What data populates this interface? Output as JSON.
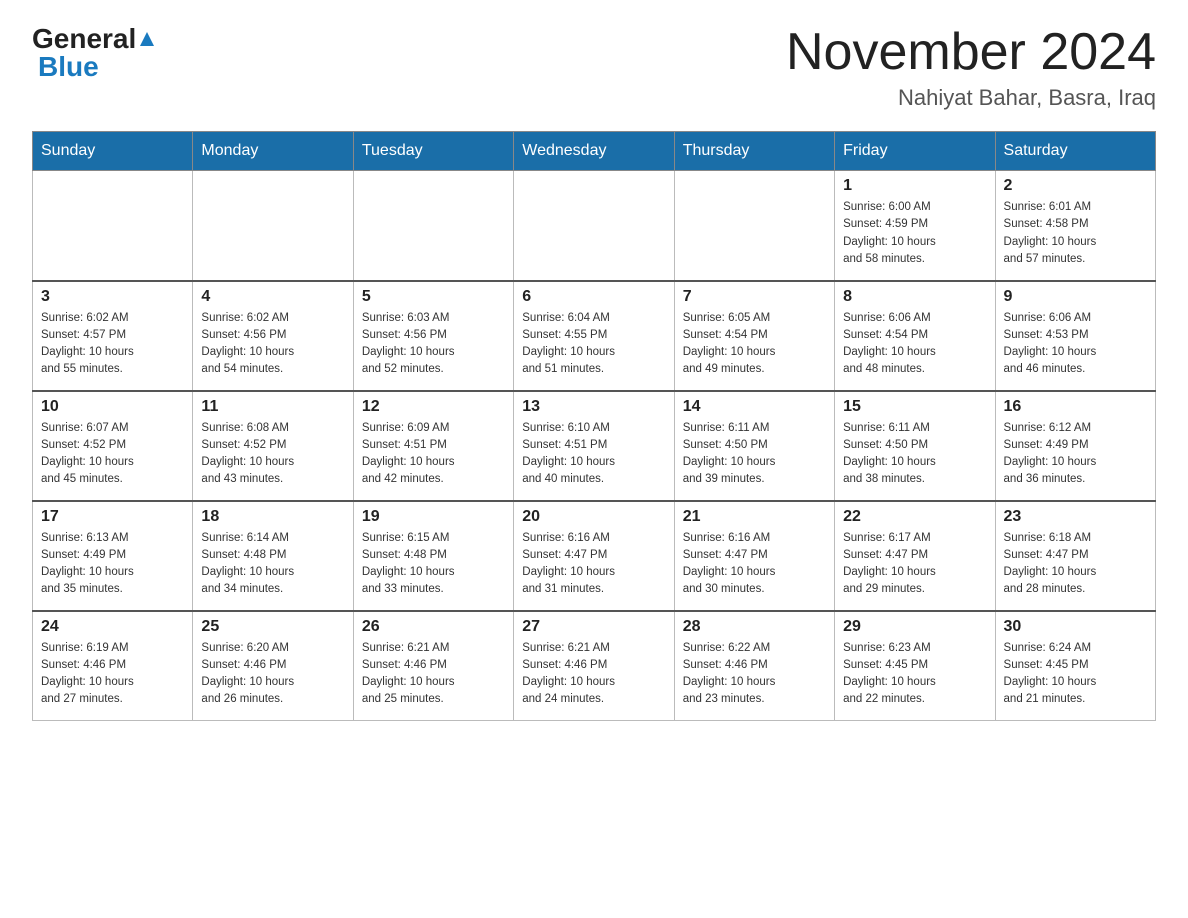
{
  "header": {
    "logo_general": "General",
    "logo_blue": "Blue",
    "month_year": "November 2024",
    "location": "Nahiyat Bahar, Basra, Iraq"
  },
  "days_of_week": [
    "Sunday",
    "Monday",
    "Tuesday",
    "Wednesday",
    "Thursday",
    "Friday",
    "Saturday"
  ],
  "weeks": [
    {
      "days": [
        {
          "num": "",
          "info": ""
        },
        {
          "num": "",
          "info": ""
        },
        {
          "num": "",
          "info": ""
        },
        {
          "num": "",
          "info": ""
        },
        {
          "num": "",
          "info": ""
        },
        {
          "num": "1",
          "info": "Sunrise: 6:00 AM\nSunset: 4:59 PM\nDaylight: 10 hours\nand 58 minutes."
        },
        {
          "num": "2",
          "info": "Sunrise: 6:01 AM\nSunset: 4:58 PM\nDaylight: 10 hours\nand 57 minutes."
        }
      ]
    },
    {
      "days": [
        {
          "num": "3",
          "info": "Sunrise: 6:02 AM\nSunset: 4:57 PM\nDaylight: 10 hours\nand 55 minutes."
        },
        {
          "num": "4",
          "info": "Sunrise: 6:02 AM\nSunset: 4:56 PM\nDaylight: 10 hours\nand 54 minutes."
        },
        {
          "num": "5",
          "info": "Sunrise: 6:03 AM\nSunset: 4:56 PM\nDaylight: 10 hours\nand 52 minutes."
        },
        {
          "num": "6",
          "info": "Sunrise: 6:04 AM\nSunset: 4:55 PM\nDaylight: 10 hours\nand 51 minutes."
        },
        {
          "num": "7",
          "info": "Sunrise: 6:05 AM\nSunset: 4:54 PM\nDaylight: 10 hours\nand 49 minutes."
        },
        {
          "num": "8",
          "info": "Sunrise: 6:06 AM\nSunset: 4:54 PM\nDaylight: 10 hours\nand 48 minutes."
        },
        {
          "num": "9",
          "info": "Sunrise: 6:06 AM\nSunset: 4:53 PM\nDaylight: 10 hours\nand 46 minutes."
        }
      ]
    },
    {
      "days": [
        {
          "num": "10",
          "info": "Sunrise: 6:07 AM\nSunset: 4:52 PM\nDaylight: 10 hours\nand 45 minutes."
        },
        {
          "num": "11",
          "info": "Sunrise: 6:08 AM\nSunset: 4:52 PM\nDaylight: 10 hours\nand 43 minutes."
        },
        {
          "num": "12",
          "info": "Sunrise: 6:09 AM\nSunset: 4:51 PM\nDaylight: 10 hours\nand 42 minutes."
        },
        {
          "num": "13",
          "info": "Sunrise: 6:10 AM\nSunset: 4:51 PM\nDaylight: 10 hours\nand 40 minutes."
        },
        {
          "num": "14",
          "info": "Sunrise: 6:11 AM\nSunset: 4:50 PM\nDaylight: 10 hours\nand 39 minutes."
        },
        {
          "num": "15",
          "info": "Sunrise: 6:11 AM\nSunset: 4:50 PM\nDaylight: 10 hours\nand 38 minutes."
        },
        {
          "num": "16",
          "info": "Sunrise: 6:12 AM\nSunset: 4:49 PM\nDaylight: 10 hours\nand 36 minutes."
        }
      ]
    },
    {
      "days": [
        {
          "num": "17",
          "info": "Sunrise: 6:13 AM\nSunset: 4:49 PM\nDaylight: 10 hours\nand 35 minutes."
        },
        {
          "num": "18",
          "info": "Sunrise: 6:14 AM\nSunset: 4:48 PM\nDaylight: 10 hours\nand 34 minutes."
        },
        {
          "num": "19",
          "info": "Sunrise: 6:15 AM\nSunset: 4:48 PM\nDaylight: 10 hours\nand 33 minutes."
        },
        {
          "num": "20",
          "info": "Sunrise: 6:16 AM\nSunset: 4:47 PM\nDaylight: 10 hours\nand 31 minutes."
        },
        {
          "num": "21",
          "info": "Sunrise: 6:16 AM\nSunset: 4:47 PM\nDaylight: 10 hours\nand 30 minutes."
        },
        {
          "num": "22",
          "info": "Sunrise: 6:17 AM\nSunset: 4:47 PM\nDaylight: 10 hours\nand 29 minutes."
        },
        {
          "num": "23",
          "info": "Sunrise: 6:18 AM\nSunset: 4:47 PM\nDaylight: 10 hours\nand 28 minutes."
        }
      ]
    },
    {
      "days": [
        {
          "num": "24",
          "info": "Sunrise: 6:19 AM\nSunset: 4:46 PM\nDaylight: 10 hours\nand 27 minutes."
        },
        {
          "num": "25",
          "info": "Sunrise: 6:20 AM\nSunset: 4:46 PM\nDaylight: 10 hours\nand 26 minutes."
        },
        {
          "num": "26",
          "info": "Sunrise: 6:21 AM\nSunset: 4:46 PM\nDaylight: 10 hours\nand 25 minutes."
        },
        {
          "num": "27",
          "info": "Sunrise: 6:21 AM\nSunset: 4:46 PM\nDaylight: 10 hours\nand 24 minutes."
        },
        {
          "num": "28",
          "info": "Sunrise: 6:22 AM\nSunset: 4:46 PM\nDaylight: 10 hours\nand 23 minutes."
        },
        {
          "num": "29",
          "info": "Sunrise: 6:23 AM\nSunset: 4:45 PM\nDaylight: 10 hours\nand 22 minutes."
        },
        {
          "num": "30",
          "info": "Sunrise: 6:24 AM\nSunset: 4:45 PM\nDaylight: 10 hours\nand 21 minutes."
        }
      ]
    }
  ]
}
